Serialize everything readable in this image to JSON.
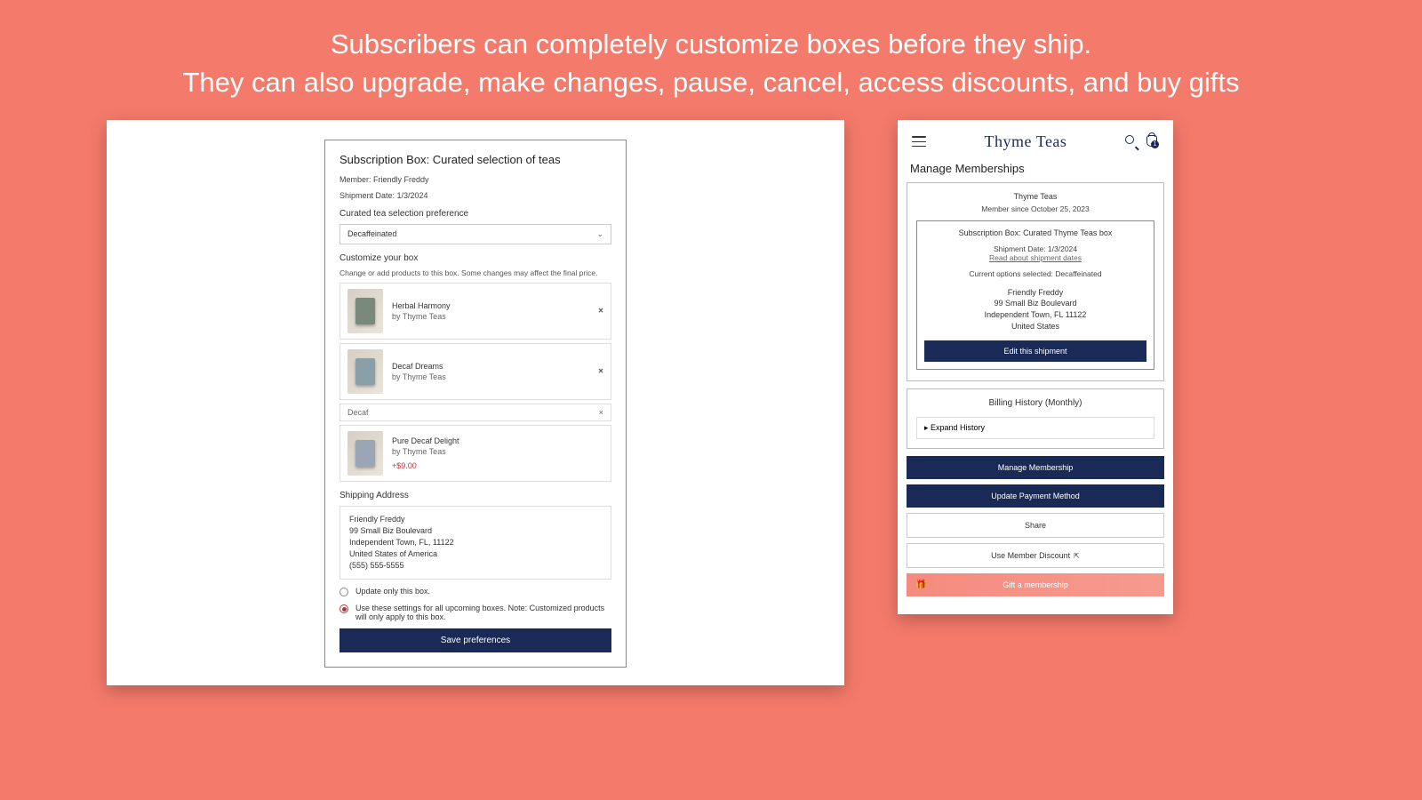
{
  "headline_line1": "Subscribers can completely customize boxes before they ship.",
  "headline_line2": "They can also upgrade, make changes, pause, cancel, access discounts, and buy gifts",
  "form": {
    "title": "Subscription Box: Curated selection of teas",
    "member_label": "Member: Friendly Freddy",
    "shipment_label": "Shipment Date: 1/3/2024",
    "pref_label": "Curated tea selection preference",
    "pref_value": "Decaffeinated",
    "customize_label": "Customize your box",
    "customize_hint": "Change or add products to this box. Some changes may affect the final price.",
    "products": [
      {
        "name": "Herbal Harmony",
        "by": "by Thyme Teas"
      },
      {
        "name": "Decaf Dreams",
        "by": "by Thyme Teas"
      }
    ],
    "search_value": "Decaf",
    "suggestion": {
      "name": "Pure Decaf Delight",
      "by": "by Thyme Teas",
      "price": "+$9.00"
    },
    "ship_label": "Shipping Address",
    "addr": {
      "name": "Friendly Freddy",
      "street": "99 Small Biz Boulevard",
      "city": "Independent Town, FL, 11122",
      "country": "United States of America",
      "phone": "(555) 555-5555"
    },
    "radio1": "Update only this box.",
    "radio2": "Use these settings for all upcoming boxes. Note: Customized products will only apply to this box.",
    "save_btn": "Save preferences"
  },
  "mobile": {
    "brand": "Thyme Teas",
    "title": "Manage Memberships",
    "store": "Thyme Teas",
    "member_since": "Member since October 25, 2023",
    "box_title": "Subscription Box: Curated Thyme Teas box",
    "ship_date": "Shipment Date: 1/3/2024",
    "ship_link": "Read about shipment dates",
    "options": "Current options selected: Decaffeinated",
    "addr_name": "Friendly Freddy",
    "addr_street": "99 Small Biz Boulevard",
    "addr_city": "Independent Town, FL 11122",
    "addr_country": "United States",
    "edit_btn": "Edit this shipment",
    "bill_title": "Billing History (Monthly)",
    "expand": "Expand History",
    "manage_btn": "Manage Membership",
    "payment_btn": "Update Payment Method",
    "share_btn": "Share",
    "discount_btn": "Use Member Discount",
    "gift_btn": "Gift a membership"
  }
}
